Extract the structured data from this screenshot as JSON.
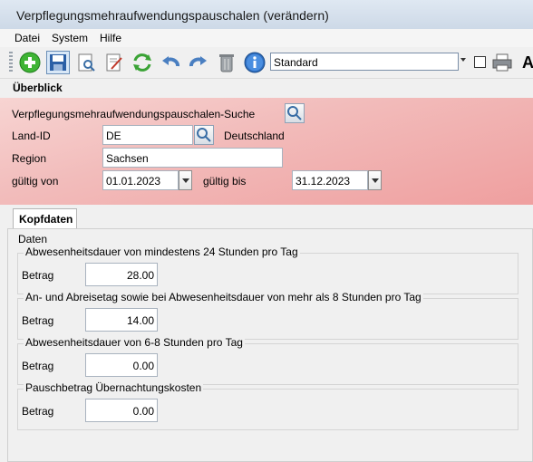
{
  "window": {
    "title": "Verpflegungsmehraufwendungspauschalen (verändern)"
  },
  "menu": [
    "Datei",
    "System",
    "Hilfe"
  ],
  "toolbar": {
    "icons": [
      "add-icon",
      "save-icon",
      "preview-icon",
      "edit-icon",
      "refresh-icon",
      "undo-icon",
      "redo-icon",
      "delete-icon",
      "info-icon"
    ],
    "layout_select": "Standard",
    "letter": "A"
  },
  "overview": {
    "title": "Überblick",
    "search_label": "Verpflegungsmehraufwendungspauschalen-Suche",
    "land_label": "Land-ID",
    "land_value": "DE",
    "land_name": "Deutschland",
    "region_label": "Region",
    "region_value": "Sachsen",
    "valid_from_label": "gültig von",
    "valid_from": "01.01.2023",
    "valid_to_label": "gültig bis",
    "valid_to": "31.12.2023"
  },
  "tab": "Kopfdaten",
  "data_section": {
    "title": "Daten",
    "groups": [
      {
        "title": "Abwesenheitsdauer von mindestens 24 Stunden pro Tag",
        "label": "Betrag",
        "value": "28.00"
      },
      {
        "title": "An- und Abreisetag sowie bei Abwesenheitsdauer von mehr als 8 Stunden pro Tag",
        "label": "Betrag",
        "value": "14.00"
      },
      {
        "title": "Abwesenheitsdauer von 6-8 Stunden pro Tag",
        "label": "Betrag",
        "value": "0.00"
      },
      {
        "title": "Pauschbetrag Übernachtungskosten",
        "label": "Betrag",
        "value": "0.00"
      }
    ]
  },
  "colors": {
    "band_light": "#f7d4d2",
    "band_dark": "#ef9f9f",
    "accent": "#3b8ed8"
  }
}
